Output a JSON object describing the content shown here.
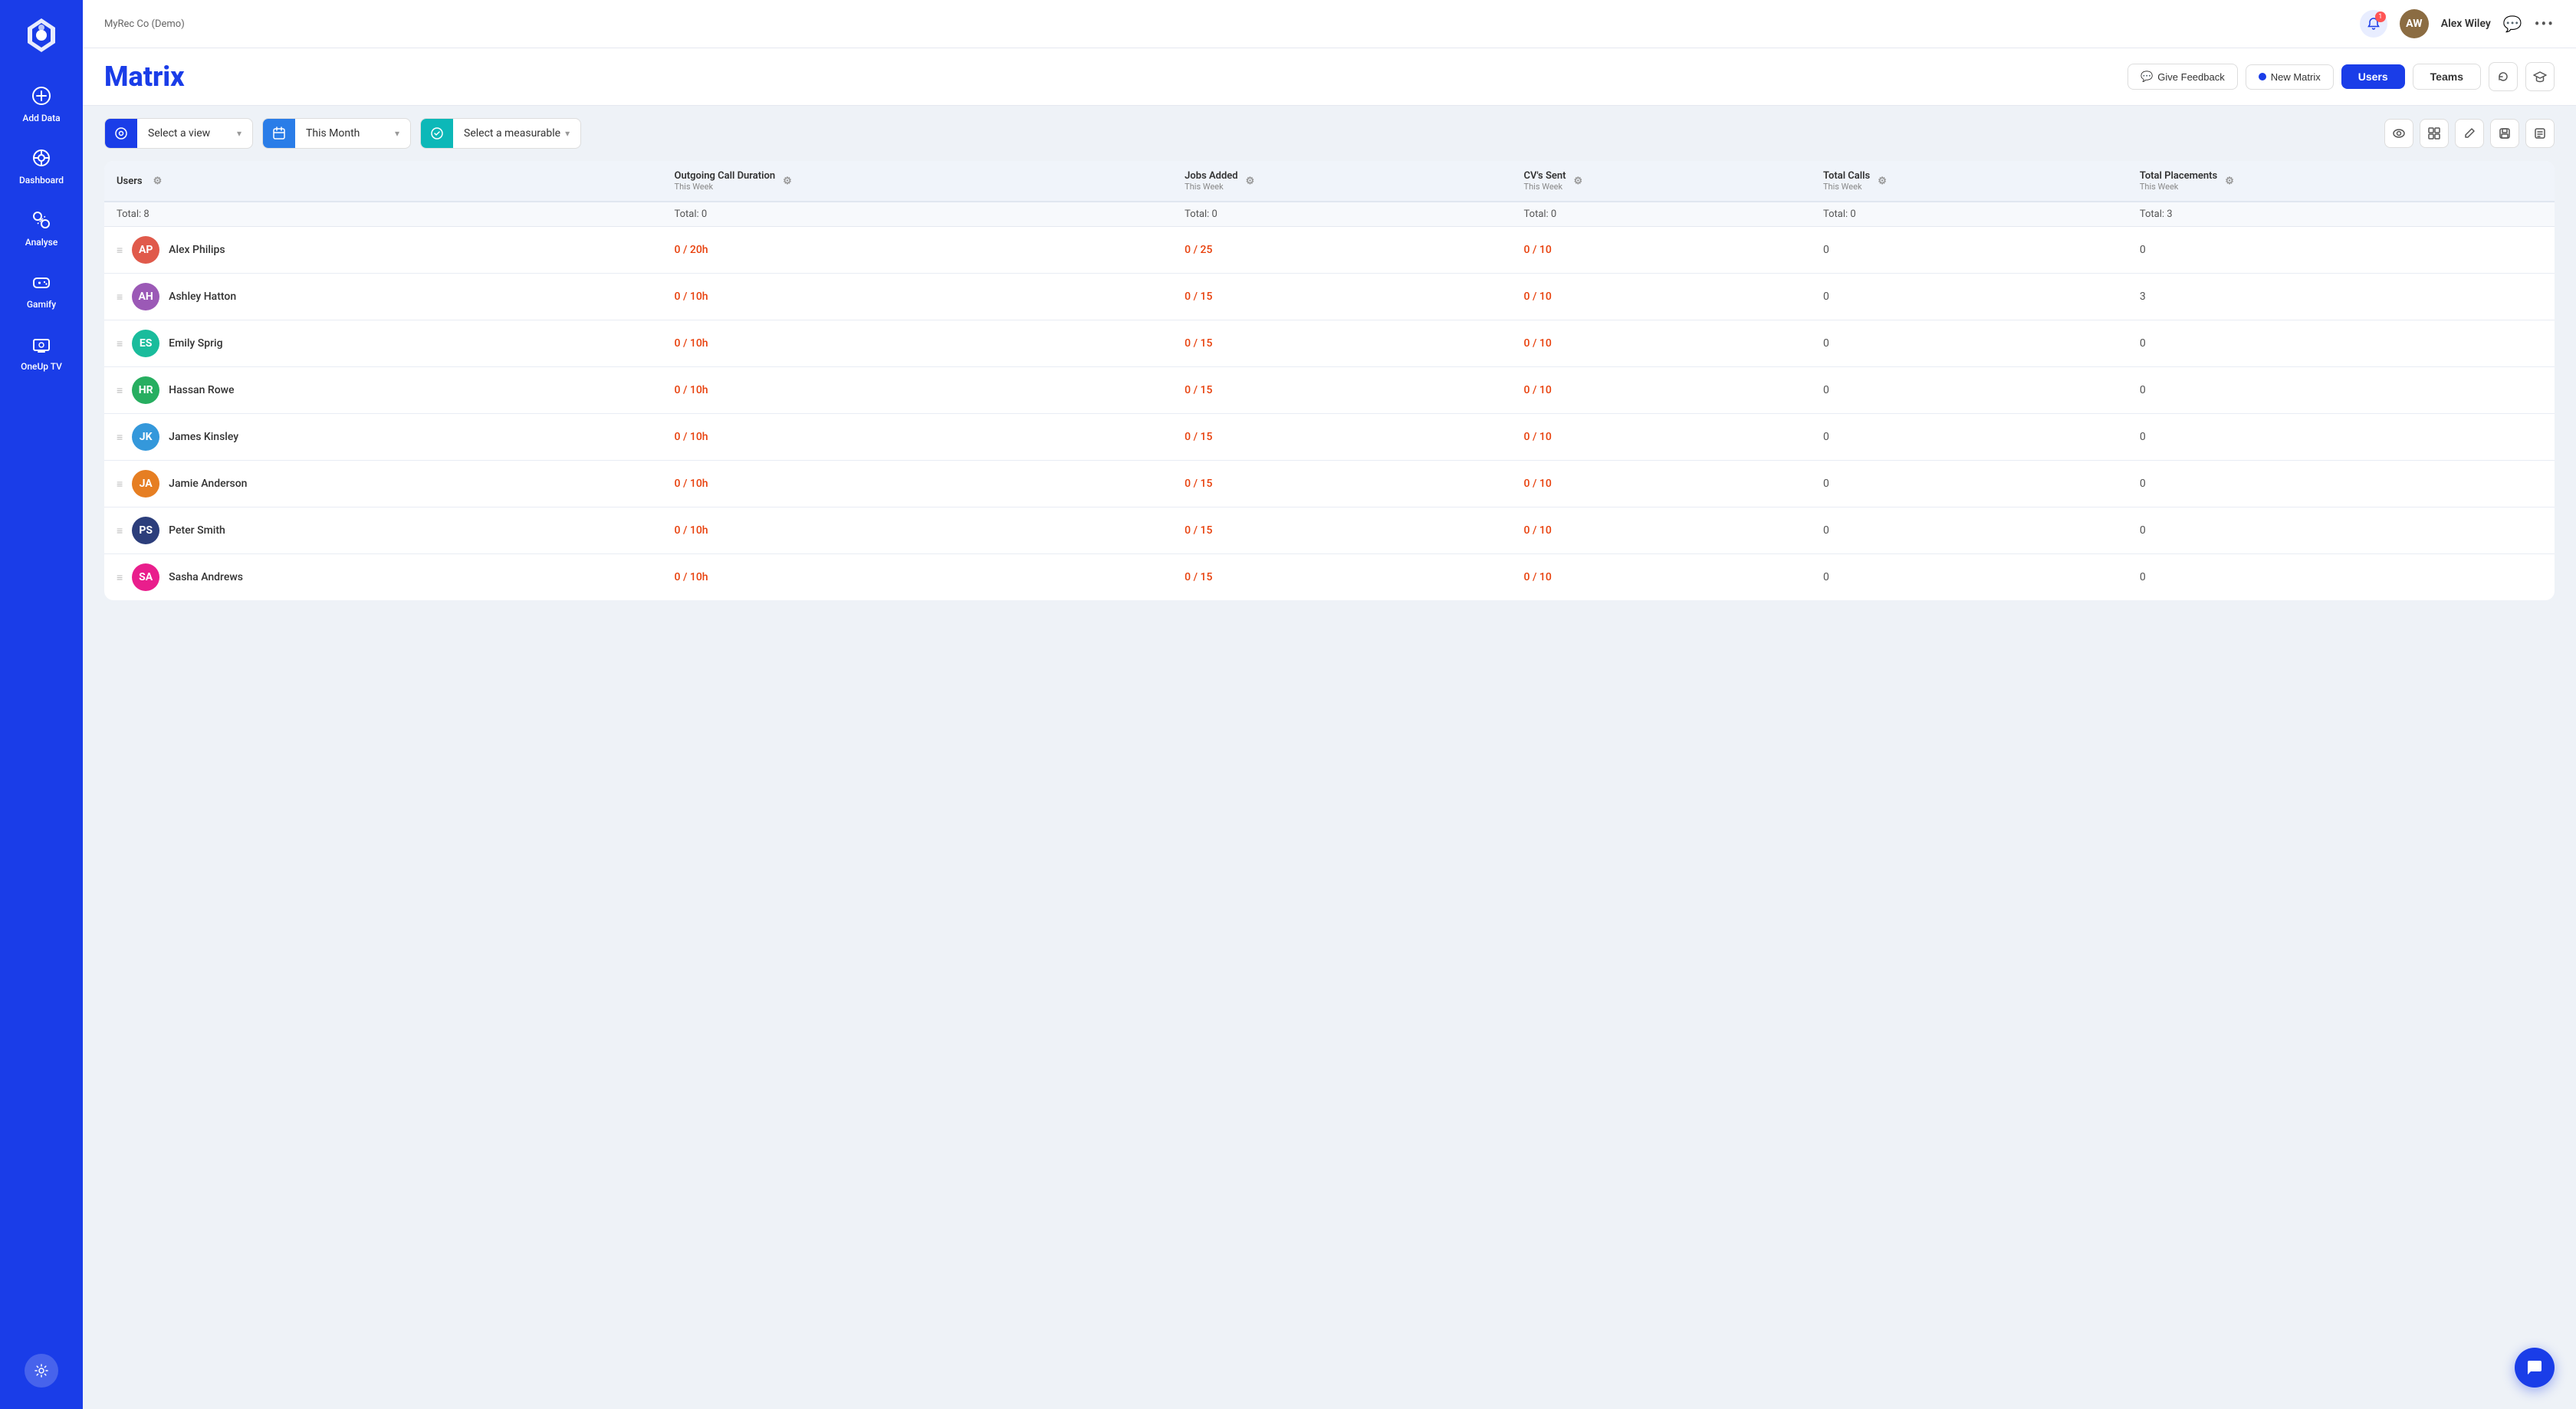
{
  "app": {
    "company": "MyRec Co (Demo)",
    "username": "Alex Wiley",
    "notif_count": "1"
  },
  "sidebar": {
    "items": [
      {
        "id": "add-data",
        "label": "Add Data",
        "icon": "⊕"
      },
      {
        "id": "dashboard",
        "label": "Dashboard",
        "icon": "⊙"
      },
      {
        "id": "analyse",
        "label": "Analyse",
        "icon": "⛶"
      },
      {
        "id": "gamify",
        "label": "Gamify",
        "icon": "🎮"
      },
      {
        "id": "oneup-tv",
        "label": "OneUp TV",
        "icon": "📺"
      }
    ]
  },
  "page": {
    "title": "Matrix",
    "feedback_label": "Give Feedback",
    "new_matrix_label": "New Matrix",
    "users_label": "Users",
    "teams_label": "Teams"
  },
  "filters": {
    "view_placeholder": "Select a view",
    "period_value": "This Month",
    "measurable_placeholder": "Select a measurable"
  },
  "table": {
    "columns": [
      {
        "id": "users",
        "title": "Users",
        "sub": ""
      },
      {
        "id": "call-duration",
        "title": "Outgoing Call Duration",
        "sub": "This Week"
      },
      {
        "id": "jobs-added",
        "title": "Jobs Added",
        "sub": "This Week"
      },
      {
        "id": "cvs-sent",
        "title": "CV's Sent",
        "sub": "This Week"
      },
      {
        "id": "total-calls",
        "title": "Total Calls",
        "sub": "This Week"
      },
      {
        "id": "total-placements",
        "title": "Total Placements",
        "sub": "This Week"
      }
    ],
    "totals": [
      "Total: 8",
      "Total: 0",
      "Total: 0",
      "Total: 0",
      "Total: 0",
      "Total: 3"
    ],
    "rows": [
      {
        "id": "alex-philips",
        "name": "Alex Philips",
        "avatar_color": "av-red",
        "avatar_initials": "AP",
        "call_duration": "0 / 20h",
        "jobs_added": "0 / 25",
        "cvs_sent": "0 / 10",
        "total_calls": "0",
        "total_placements": "0",
        "call_red": true,
        "jobs_red": true,
        "cvs_red": true
      },
      {
        "id": "ashley-hatton",
        "name": "Ashley Hatton",
        "avatar_color": "av-purple",
        "avatar_initials": "AH",
        "call_duration": "0 / 10h",
        "jobs_added": "0 / 15",
        "cvs_sent": "0 / 10",
        "total_calls": "0",
        "total_placements": "3",
        "call_red": true,
        "jobs_red": true,
        "cvs_red": true
      },
      {
        "id": "emily-sprig",
        "name": "Emily Sprig",
        "avatar_color": "av-teal",
        "avatar_initials": "ES",
        "call_duration": "0 / 10h",
        "jobs_added": "0 / 15",
        "cvs_sent": "0 / 10",
        "total_calls": "0",
        "total_placements": "0",
        "call_red": true,
        "jobs_red": true,
        "cvs_red": true
      },
      {
        "id": "hassan-rowe",
        "name": "Hassan Rowe",
        "avatar_color": "av-green",
        "avatar_initials": "HR",
        "call_duration": "0 / 10h",
        "jobs_added": "0 / 15",
        "cvs_sent": "0 / 10",
        "total_calls": "0",
        "total_placements": "0",
        "call_red": true,
        "jobs_red": true,
        "cvs_red": true
      },
      {
        "id": "james-kinsley",
        "name": "James Kinsley",
        "avatar_color": "av-blue",
        "avatar_initials": "JK",
        "call_duration": "0 / 10h",
        "jobs_added": "0 / 15",
        "cvs_sent": "0 / 10",
        "total_calls": "0",
        "total_placements": "0",
        "call_red": true,
        "jobs_red": true,
        "cvs_red": true
      },
      {
        "id": "jamie-anderson",
        "name": "Jamie Anderson",
        "avatar_color": "av-orange",
        "avatar_initials": "JA",
        "call_duration": "0 / 10h",
        "jobs_added": "0 / 15",
        "cvs_sent": "0 / 10",
        "total_calls": "0",
        "total_placements": "0",
        "call_red": true,
        "jobs_red": true,
        "cvs_red": true
      },
      {
        "id": "peter-smith",
        "name": "Peter Smith",
        "avatar_color": "av-darkblue",
        "avatar_initials": "PS",
        "call_duration": "0 / 10h",
        "jobs_added": "0 / 15",
        "cvs_sent": "0 / 10",
        "total_calls": "0",
        "total_placements": "0",
        "call_red": true,
        "jobs_red": true,
        "cvs_red": true
      },
      {
        "id": "sasha-andrews",
        "name": "Sasha Andrews",
        "avatar_color": "av-pink",
        "avatar_initials": "SA",
        "call_duration": "0 / 10h",
        "jobs_added": "0 / 15",
        "cvs_sent": "0 / 10",
        "total_calls": "0",
        "total_placements": "0",
        "call_red": true,
        "jobs_red": true,
        "cvs_red": true
      }
    ]
  }
}
